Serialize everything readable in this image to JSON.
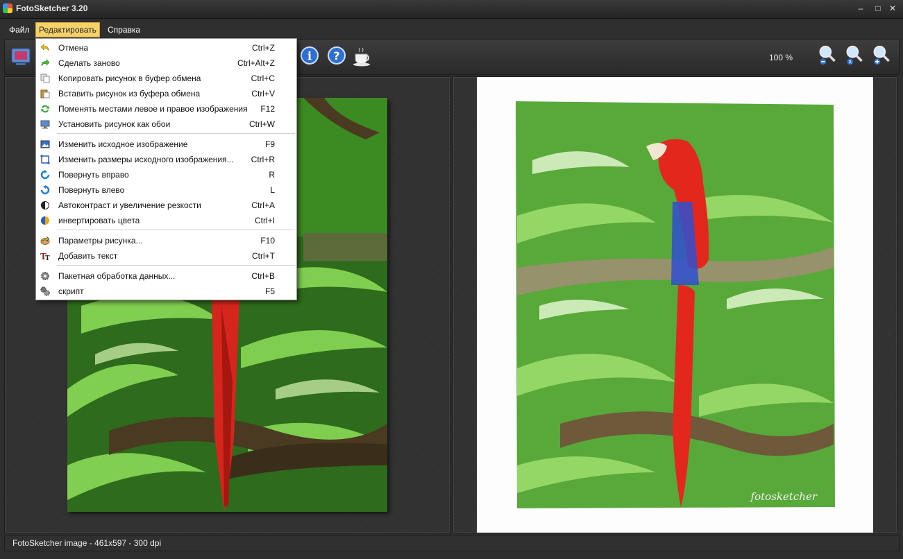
{
  "window": {
    "title": "FotoSketcher 3.20"
  },
  "window_controls": {
    "minimize": "–",
    "maximize": "□",
    "close": "✕"
  },
  "menubar": {
    "file": "Файл",
    "edit": "Редактировать",
    "help": "Справка"
  },
  "toolbar": {
    "zoom_level": "100 %"
  },
  "edit_menu": {
    "items": [
      {
        "label": "Отмена",
        "shortcut": "Ctrl+Z",
        "icon": "undo-icon"
      },
      {
        "label": "Сделать заново",
        "shortcut": "Ctrl+Alt+Z",
        "icon": "redo-icon"
      },
      {
        "label": "Копировать рисунок в буфер обмена",
        "shortcut": "Ctrl+C",
        "icon": "copy-icon"
      },
      {
        "label": "Вставить рисунок из буфера обмена",
        "shortcut": "Ctrl+V",
        "icon": "paste-icon"
      },
      {
        "label": "Поменять местами левое и правое изображения",
        "shortcut": "F12",
        "icon": "swap-icon"
      },
      {
        "label": "Установить рисунок как обои",
        "shortcut": "Ctrl+W",
        "icon": "wallpaper-icon"
      },
      {
        "label": "Изменить исходное изображение",
        "shortcut": "F9",
        "icon": "edit-image-icon"
      },
      {
        "label": "Изменить размеры исходного изображения...",
        "shortcut": "Ctrl+R",
        "icon": "resize-icon"
      },
      {
        "label": "Повернуть вправо",
        "shortcut": "R",
        "icon": "rotate-right-icon"
      },
      {
        "label": "Повернуть влево",
        "shortcut": "L",
        "icon": "rotate-left-icon"
      },
      {
        "label": "Автоконтраст и увеличение резкости",
        "shortcut": "Ctrl+A",
        "icon": "autocontrast-icon"
      },
      {
        "label": "инвертировать цвета",
        "shortcut": "Ctrl+I",
        "icon": "invert-colors-icon"
      },
      {
        "label": "Параметры рисунка...",
        "shortcut": "F10",
        "icon": "palette-icon"
      },
      {
        "label": "Добавить текст",
        "shortcut": "Ctrl+T",
        "icon": "text-icon"
      },
      {
        "label": "Пакетная обработка данных...",
        "shortcut": "Ctrl+B",
        "icon": "batch-gear-icon"
      },
      {
        "label": "скрипт",
        "shortcut": "F5",
        "icon": "script-gears-icon"
      }
    ]
  },
  "status": {
    "text": "FotoSketcher image - 461x597 - 300 dpi"
  },
  "watermark": "fotosketcher"
}
